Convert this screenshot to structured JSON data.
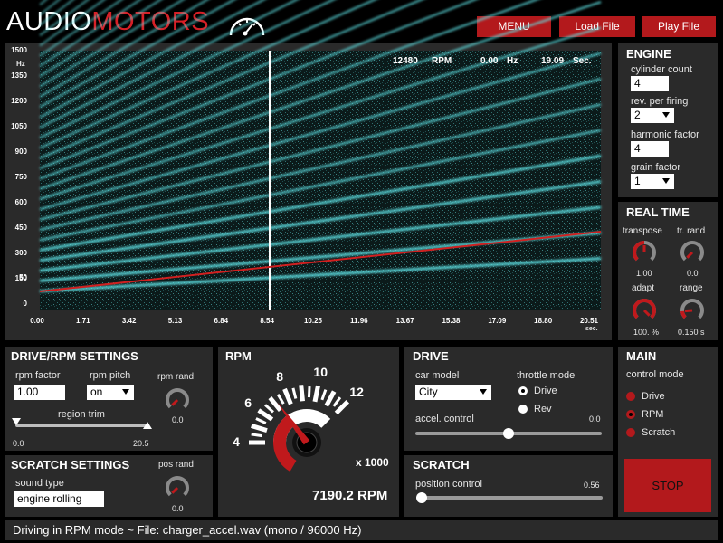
{
  "app": {
    "logo_audio": "AUDIO",
    "logo_motors": "MOTORS",
    "menu_label": "MENU",
    "load_label": "Load File",
    "play_label": "Play File"
  },
  "colors": {
    "accent": "#b3191c",
    "panel": "#2a2a2a",
    "background": "#000000",
    "spectrogram_line": "#5fe3e6"
  },
  "spectrogram": {
    "rpm_value": "12480",
    "rpm_unit": "RPM",
    "hz_value": "0.00",
    "hz_unit": "Hz",
    "time_value": "19.09",
    "time_unit": "Sec.",
    "y_unit": "Hz",
    "y_ticks": [
      "1500",
      "1350",
      "1200",
      "1050",
      "900",
      "750",
      "600",
      "450",
      "300",
      "150",
      "50",
      "0"
    ],
    "x_ticks": [
      "0.00",
      "1.71",
      "3.42",
      "5.13",
      "6.84",
      "8.54",
      "10.25",
      "11.96",
      "13.67",
      "15.38",
      "17.09",
      "18.80",
      "20.51"
    ],
    "x_unit": "sec.",
    "cursor_time": 8.54
  },
  "engine": {
    "title": "ENGINE",
    "cyl_label": "cylinder count",
    "cyl_value": "4",
    "rev_label": "rev. per firing",
    "rev_value": "2",
    "harm_label": "harmonic factor",
    "harm_value": "4",
    "grain_label": "grain factor",
    "grain_value": "1"
  },
  "realtime": {
    "title": "REAL TIME",
    "transpose_label": "transpose",
    "transpose_value": "1.00",
    "trrand_label": "tr. rand",
    "trrand_value": "0.0",
    "adapt_label": "adapt",
    "adapt_value": "100. %",
    "range_label": "range",
    "range_value": "0.150 s"
  },
  "drive_rpm": {
    "title": "DRIVE/RPM SETTINGS",
    "rpm_factor_label": "rpm factor",
    "rpm_factor_value": "1.00",
    "rpm_pitch_label": "rpm pitch",
    "rpm_pitch_value": "on",
    "rpm_rand_label": "rpm rand",
    "rpm_rand_value": "0.0",
    "region_label": "region trim",
    "region_min": "0.0",
    "region_max": "20.5"
  },
  "scratch_settings": {
    "title": "SCRATCH SETTINGS",
    "sound_type_label": "sound type",
    "sound_type_value": "engine rolling",
    "pos_rand_label": "pos rand",
    "pos_rand_value": "0.0"
  },
  "rpm": {
    "title": "RPM",
    "gauge_labels": [
      "4",
      "6",
      "8",
      "10",
      "12"
    ],
    "multiplier": "x 1000",
    "readout": "7190.2 RPM",
    "gauge_value": 7.19
  },
  "drive": {
    "title": "DRIVE",
    "car_model_label": "car model",
    "car_model_value": "City",
    "throttle_label": "throttle mode",
    "opt_drive": "Drive",
    "opt_rev": "Rev",
    "accel_label": "accel. control",
    "accel_value": "0.0"
  },
  "scratch": {
    "title": "SCRATCH",
    "position_label": "position control",
    "position_value": "0.56"
  },
  "main": {
    "title": "MAIN",
    "control_label": "control mode",
    "opt_drive": "Drive",
    "opt_rpm": "RPM",
    "opt_scratch": "Scratch",
    "stop_label": "STOP"
  },
  "status": {
    "text": "Driving in RPM mode ~ File: charger_accel.wav (mono / 96000 Hz)"
  }
}
